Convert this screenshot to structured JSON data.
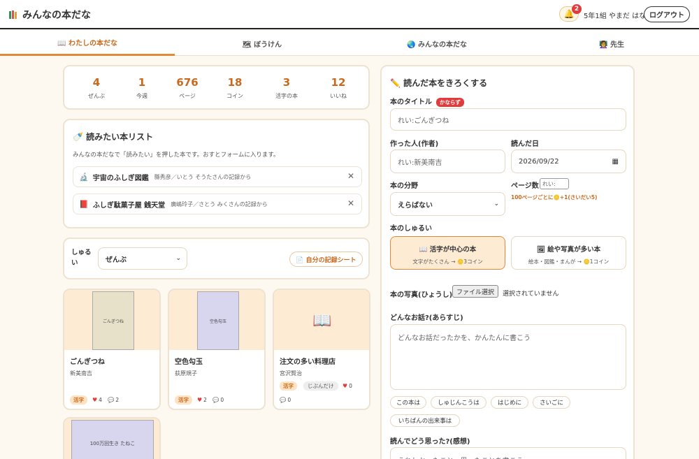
{
  "header": {
    "app_title": "みんなの本だな",
    "notification_count": "2",
    "user_label": "5年1組 やまだ はな",
    "logout_label": "ログアウト"
  },
  "tabs": [
    {
      "label": "📖 わたしの本だな",
      "active": true
    },
    {
      "label": "🗺 ぼうけん"
    },
    {
      "label": "🌏 みんなの本だな"
    },
    {
      "label": "👩‍🏫 先生"
    }
  ],
  "stats": [
    {
      "value": "4",
      "label": "ぜんぶ"
    },
    {
      "value": "1",
      "label": "今週"
    },
    {
      "value": "676",
      "label": "ページ"
    },
    {
      "value": "18",
      "label": "コイン"
    },
    {
      "value": "3",
      "label": "活字の本"
    },
    {
      "value": "12",
      "label": "いいね"
    }
  ],
  "wishlist": {
    "title": "🍼 読みたい本リスト",
    "description": "みんなの本だなで「読みたい」を押した本です。おすとフォームに入ります。",
    "items": [
      {
        "icon": "🔬",
        "title": "宇宙のふしぎ図鑑",
        "meta": "縣秀彦／いとう そうたさんの記録から"
      },
      {
        "icon": "📕",
        "title": "ふしぎ駄菓子屋 銭天堂",
        "meta": "廣嶋玲子／さとう みくさんの記録から"
      }
    ]
  },
  "filter": {
    "label": "しゅるい",
    "selected": "ぜんぶ",
    "sheet_button": "📄 自分の記録シート"
  },
  "books": [
    {
      "title": "ごんぎつね",
      "author": "新美南吉",
      "cover_text": "ごんぎつね",
      "tags": [
        "活字"
      ],
      "likes": "4",
      "comments": "2"
    },
    {
      "title": "空色勾玉",
      "author": "荻原規子",
      "cover_text": "空色勾玉",
      "tags": [
        "活字"
      ],
      "likes": "2",
      "comments": "0"
    },
    {
      "title": "注文の多い料理店",
      "author": "宮沢賢治",
      "tags": [
        "活字",
        "じぶんだけ"
      ],
      "likes": "0",
      "comments": "0"
    },
    {
      "cover_text": "100万回生き たねこ"
    }
  ],
  "form": {
    "title": "✏️ 読んだ本をきろくする",
    "book_title_label": "本のタイトル",
    "required_label": "かならず",
    "book_title_placeholder": "れい:ごんぎつね",
    "author_label": "作った人(作者)",
    "author_placeholder": "れい:新美南吉",
    "date_label": "読んだ日",
    "date_value": "2026/09/22",
    "genre_label": "本の分野",
    "genre_selected": "えらばない",
    "pages_label": "ページ数",
    "pages_placeholder": "れい:",
    "pages_hint": "100ページごとに🪙+1(さいだい5)",
    "type_label": "本のしゅるい",
    "type_options": [
      {
        "title": "📖 活字が中心の本",
        "sub": "文字がたくさん → 🪙3コイン",
        "active": true
      },
      {
        "title": "🖼 絵や写真が多い本",
        "sub": "絵本・図鑑・まんが → 🪙1コイン"
      }
    ],
    "photo_label": "本の写真(ひょうし)",
    "file_button": "ファイル選択",
    "file_status": "選択されていません",
    "summary_label": "どんなお話?(あらすじ)",
    "summary_placeholder": "どんなお話だったかを、かんたんに書こう",
    "chips": [
      "この本は",
      "しゅじんこうは",
      "はじめに",
      "さいごに",
      "いちばんの出来事は"
    ],
    "impression_label": "読んでどう思った?(感想)",
    "impression_placeholder": "うれしかったこと、思ったことを書こう"
  },
  "colors": {
    "accent": "#c86a1e",
    "background": "#fdf8f0",
    "cover_bg": "#fdebd4"
  }
}
